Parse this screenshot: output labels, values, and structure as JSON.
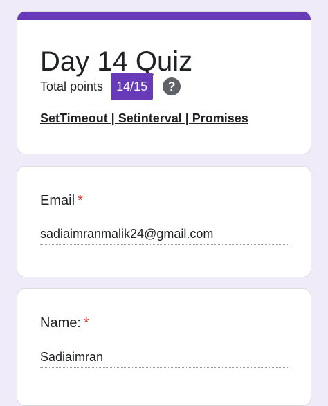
{
  "header": {
    "title": "Day 14 Quiz",
    "total_points_label": "Total points",
    "score": "14/15",
    "help_icon_glyph": "?",
    "description": "SetTimeout | Setinterval | Promises",
    "accent_color": "#673ab7"
  },
  "questions": [
    {
      "label": "Email",
      "required_marker": "*",
      "answer": "sadiaimranmalik24@gmail.com"
    },
    {
      "label": "Name:",
      "required_marker": "*",
      "answer": "Sadiaimran"
    }
  ],
  "colors": {
    "page_background": "#f0ebf8",
    "accent": "#673ab7",
    "required": "#d93025"
  },
  "icons": {
    "help": "help-circle-icon"
  }
}
